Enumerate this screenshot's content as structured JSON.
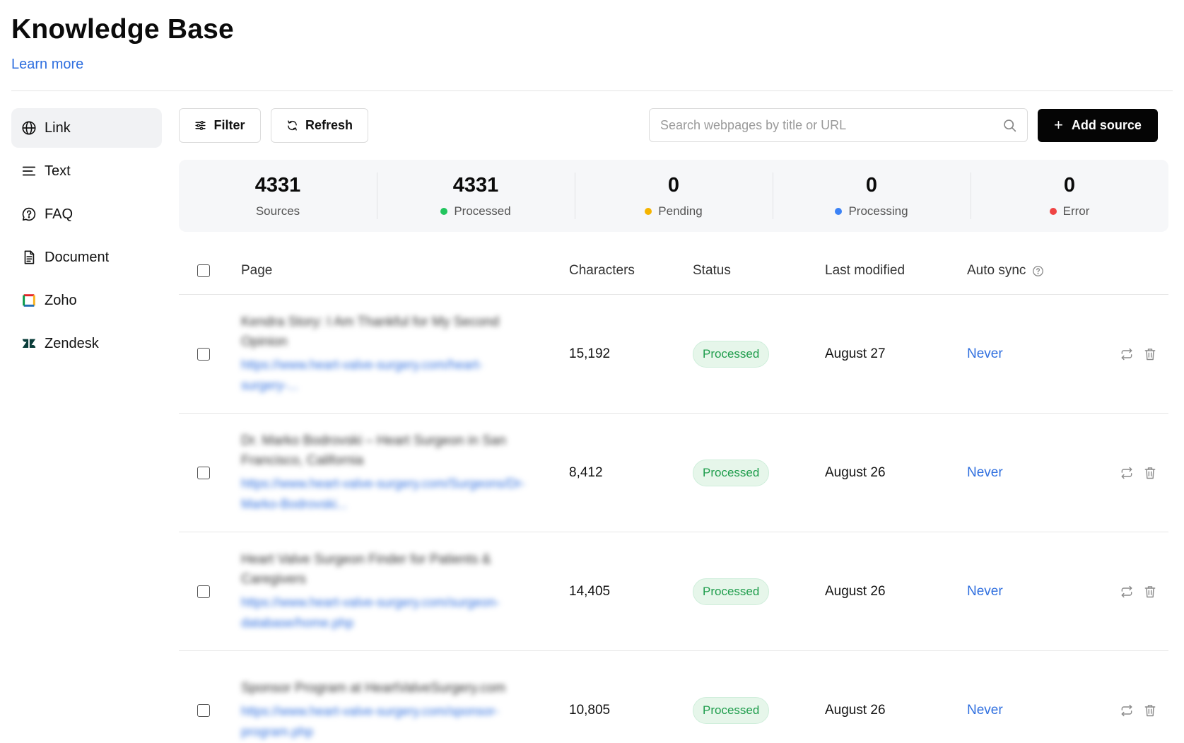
{
  "header": {
    "title": "Knowledge Base",
    "learn_more": "Learn more"
  },
  "sidebar": {
    "items": [
      {
        "label": "Link",
        "icon": "globe-icon",
        "active": true
      },
      {
        "label": "Text",
        "icon": "text-lines-icon"
      },
      {
        "label": "FAQ",
        "icon": "chat-question-icon"
      },
      {
        "label": "Document",
        "icon": "document-icon"
      },
      {
        "label": "Zoho",
        "icon": "zoho-logo-icon"
      },
      {
        "label": "Zendesk",
        "icon": "zendesk-logo-icon"
      }
    ]
  },
  "toolbar": {
    "filter_label": "Filter",
    "refresh_label": "Refresh",
    "search_placeholder": "Search webpages by title or URL",
    "add_label": "Add source"
  },
  "stats": [
    {
      "value": "4331",
      "label": "Sources",
      "color": ""
    },
    {
      "value": "4331",
      "label": "Processed",
      "color": "#22c55e"
    },
    {
      "value": "0",
      "label": "Pending",
      "color": "#f5b400"
    },
    {
      "value": "0",
      "label": "Processing",
      "color": "#3b82f6"
    },
    {
      "value": "0",
      "label": "Error",
      "color": "#ef4444"
    }
  ],
  "table": {
    "columns": {
      "page": "Page",
      "characters": "Characters",
      "status": "Status",
      "last_modified": "Last modified",
      "auto_sync": "Auto sync"
    },
    "rows": [
      {
        "title": "Kendra Story: I Am Thankful for My Second Opinion",
        "url": "https://www.heart-valve-surgery.com/heart-surgery-...",
        "characters": "15,192",
        "status": "Processed",
        "last_modified": "August 27",
        "auto_sync": "Never"
      },
      {
        "title": "Dr. Marko Bodrovski – Heart Surgeon in San Francisco, California",
        "url": "https://www.heart-valve-surgery.com/Surgeons/Dr-Marko-Bodrovski...",
        "characters": "8,412",
        "status": "Processed",
        "last_modified": "August 26",
        "auto_sync": "Never"
      },
      {
        "title": "Heart Valve Surgeon Finder for Patients & Caregivers",
        "url": "https://www.heart-valve-surgery.com/surgeon-database/home.php",
        "characters": "14,405",
        "status": "Processed",
        "last_modified": "August 26",
        "auto_sync": "Never"
      },
      {
        "title": "Sponsor Program at HeartValveSurgery.com",
        "url": "https://www.heart-valve-surgery.com/sponsor-program.php",
        "characters": "10,805",
        "status": "Processed",
        "last_modified": "August 26",
        "auto_sync": "Never"
      }
    ]
  },
  "colors": {
    "accent_link": "#2f6fdf",
    "primary_button": "#050505",
    "badge_bg": "#e6f6ea",
    "badge_text": "#1f9d4c"
  }
}
